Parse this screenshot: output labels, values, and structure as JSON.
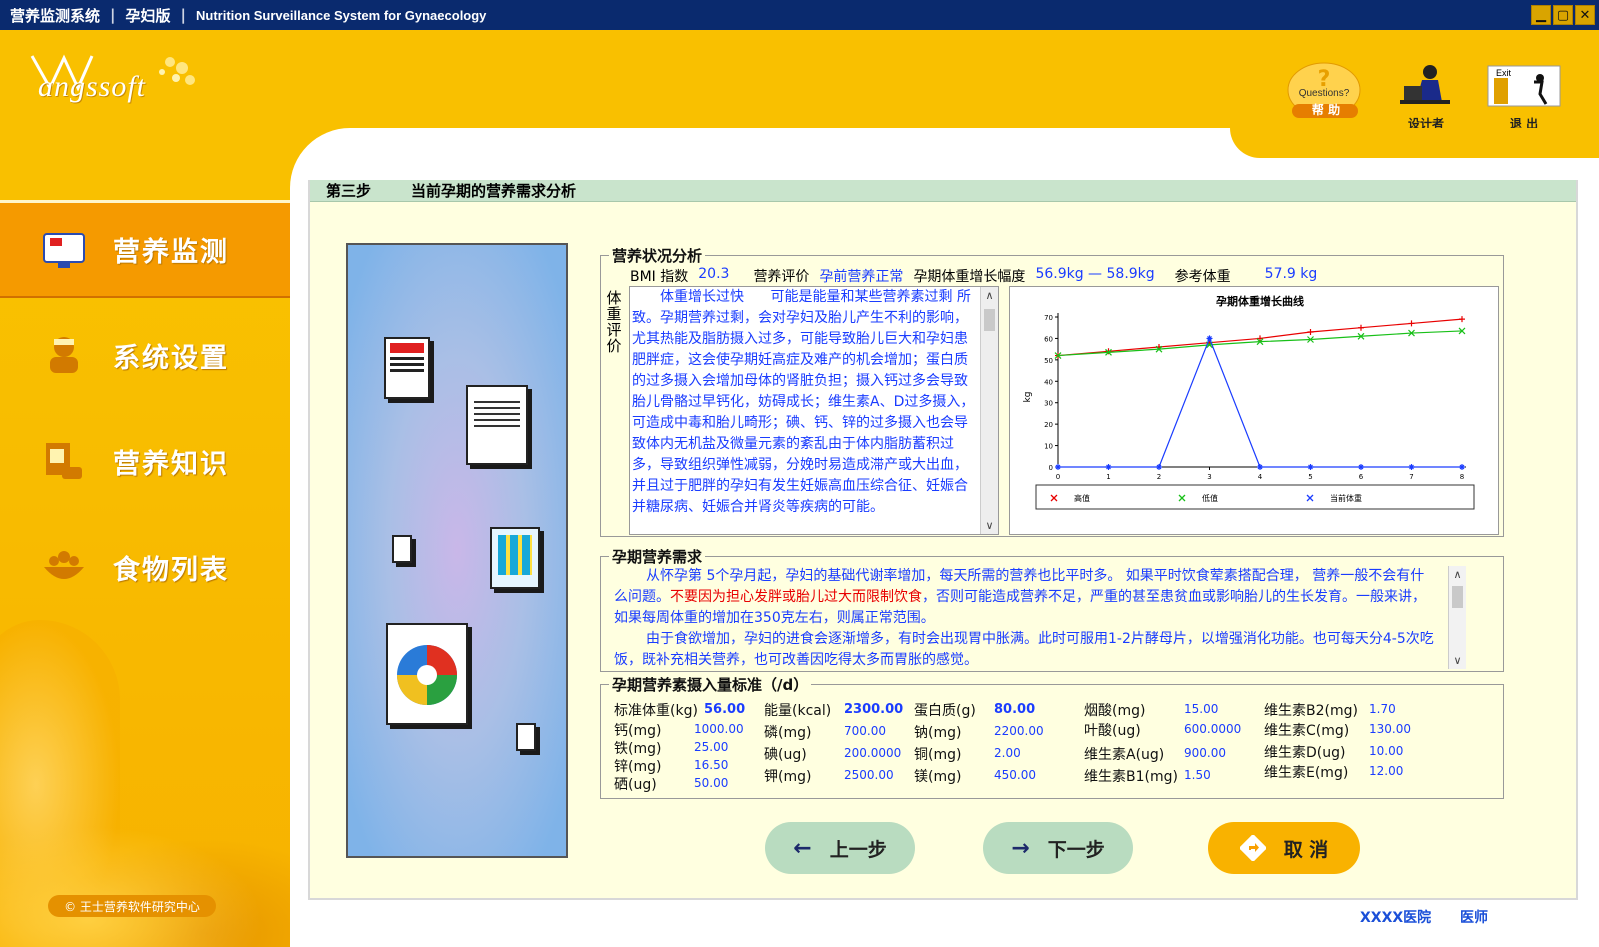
{
  "titlebar": {
    "app_name": "营养监测系统",
    "edition": "孕妇版",
    "english": "Nutrition Surveillance  System for Gynaecology"
  },
  "logo": {
    "text": "angssoft"
  },
  "top_actions": [
    {
      "label": "帮 助",
      "icon": "questions-icon",
      "inner": "Questions?"
    },
    {
      "label": "设计者",
      "icon": "designer-icon"
    },
    {
      "label": "退 出",
      "icon": "exit-icon",
      "inner": "Exit"
    }
  ],
  "sidebar": {
    "items": [
      {
        "label": "营养监测",
        "icon": "monitor-icon",
        "active": true
      },
      {
        "label": "系统设置",
        "icon": "settings-person-icon",
        "active": false
      },
      {
        "label": "营养知识",
        "icon": "knowledge-icon",
        "active": false
      },
      {
        "label": "食物列表",
        "icon": "food-basket-icon",
        "active": false
      }
    ],
    "copyright": "© 王士营养软件研究中心"
  },
  "step": {
    "number": "第三步",
    "title": "当前孕期的营养需求分析"
  },
  "status": {
    "section_title": "营养状况分析",
    "bmi_label": "BMI 指数",
    "bmi_value": "20.3",
    "eval_label": "营养评价",
    "eval_value": "孕前营养正常",
    "gain_label": "孕期体重增长幅度",
    "gain_value": "56.9kg — 58.9kg",
    "ref_label": "参考体重",
    "ref_value": "57.9 kg",
    "weight_eval_label": "体重评价",
    "weight_eval_title": "体重增长过快",
    "weight_eval_hint": "可能是能量和某些营养素过剩",
    "weight_eval_text": "所致。孕期营养过剩，会对孕妇及胎儿产生不利的影响，尤其热能及脂肪摄入过多，可能导致胎儿巨大和孕妇患肥胖症，这会使孕期妊高症及难产的机会增加；蛋白质的过多摄入会增加母体的肾脏负担；摄入钙过多会导致胎儿骨骼过早钙化，妨碍成长；维生素A、D过多摄入，可造成中毒和胎儿畸形；碘、钙、锌的过多摄入也会导致体内无机盐及微量元素的紊乱由于体内脂肪蓄积过多，导致组织弹性减弱，分娩时易造成滞产或大出血，并且过于肥胖的孕妇有发生妊娠高血压综合征、妊娠合并糖尿病、妊娠合并肾炎等疾病的可能。"
  },
  "chart_data": {
    "type": "line",
    "title": "孕期体重增长曲线",
    "ylabel": "kg",
    "xlabel": "",
    "x": [
      0,
      1,
      2,
      3,
      4,
      5,
      6,
      7,
      8
    ],
    "ylim": [
      0,
      70
    ],
    "yticks": [
      0,
      10,
      20,
      30,
      40,
      50,
      60,
      70
    ],
    "series": [
      {
        "name": "高值",
        "color": "#e80000",
        "marker": "cross-red",
        "values": [
          52,
          54,
          56,
          58,
          60,
          63,
          65,
          67,
          69
        ]
      },
      {
        "name": "低值",
        "color": "#18c018",
        "marker": "x",
        "values": [
          52,
          53.5,
          55,
          57,
          58.5,
          59.5,
          61,
          62.5,
          63.5
        ]
      },
      {
        "name": "当前体重",
        "color": "#1a3cff",
        "marker": "star",
        "values": [
          0,
          0,
          0,
          60,
          0,
          0,
          0,
          0,
          0
        ]
      }
    ],
    "legend": "bottom"
  },
  "needs": {
    "section_title": "孕期营养需求",
    "p1_a": "从怀孕第 5个孕月起，孕妇的基础代谢率增加，每天所需的营养也比平时多。 如果平时饮食荤素搭配合理， 营养一般不会有什么问题。",
    "p1_red": "不要因为担心发胖或胎儿过大而限制饮食",
    "p1_b": "，否则可能造成营养不足，严重的甚至患贫血或影响胎儿的生长发育。一般来讲，如果每周体重的增加在350克左右，则属正常范围。",
    "p2": "由于食欲增加，孕妇的进食会逐渐增多，有时会出现胃中胀满。此时可服用1-2片酵母片，以增强消化功能。也可每天分4-5次吃饭，既补充相关营养，也可改善因吃得太多而胃胀的感觉。"
  },
  "standards": {
    "section_title": "孕期营养素摄入量标准（/d）",
    "items": [
      {
        "label": "标准体重(kg)",
        "value": "56.00"
      },
      {
        "label": "能量(kcal)",
        "value": "2300.00"
      },
      {
        "label": "蛋白质(g)",
        "value": "80.00"
      },
      {
        "label": "烟酸(mg)",
        "value": "15.00"
      },
      {
        "label": "维生素B2(mg)",
        "value": "1.70"
      },
      {
        "label": "钙(mg)",
        "value": "1000.00"
      },
      {
        "label": "铁(mg)",
        "value": "25.00"
      },
      {
        "label": "锌(mg)",
        "value": "16.50"
      },
      {
        "label": "硒(ug)",
        "value": "50.00"
      },
      {
        "label": "磷(mg)",
        "value": "700.00"
      },
      {
        "label": "碘(ug)",
        "value": "200.0000"
      },
      {
        "label": "钾(mg)",
        "value": "2500.00"
      },
      {
        "label": "钠(mg)",
        "value": "2200.00"
      },
      {
        "label": "铜(mg)",
        "value": "2.00"
      },
      {
        "label": "镁(mg)",
        "value": "450.00"
      },
      {
        "label": "叶酸(ug)",
        "value": "600.0000"
      },
      {
        "label": "维生素A(ug)",
        "value": "900.00"
      },
      {
        "label": "维生素B1(mg)",
        "value": "1.50"
      },
      {
        "label": "维生素C(mg)",
        "value": "130.00"
      },
      {
        "label": "维生素D(ug)",
        "value": "10.00"
      },
      {
        "label": "维生素E(mg)",
        "value": "12.00"
      }
    ]
  },
  "buttons": {
    "prev": "上一步",
    "next": "下一步",
    "cancel": "取 消"
  },
  "footer": {
    "hospital": "XXXX医院",
    "doctor": "医师"
  }
}
